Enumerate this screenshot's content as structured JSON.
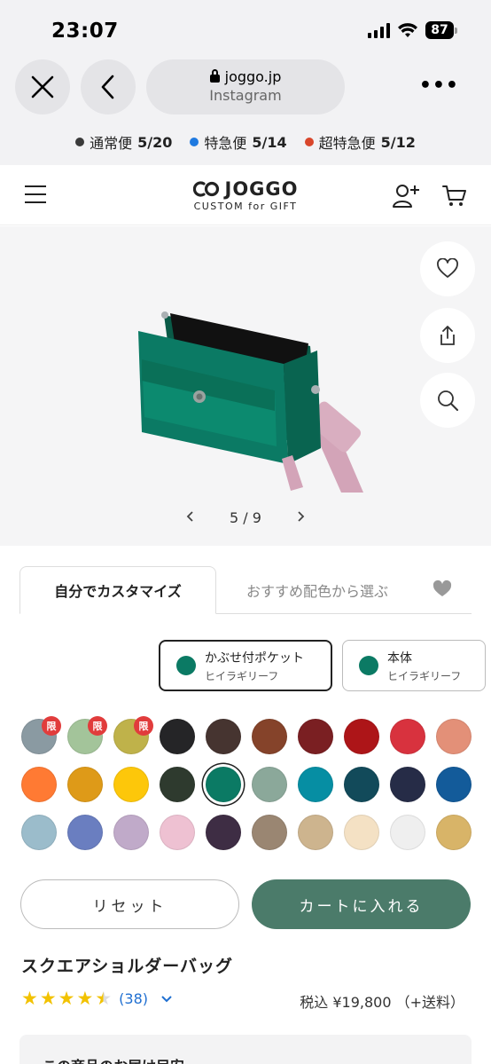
{
  "status": {
    "time": "23:07",
    "battery": "87"
  },
  "browser": {
    "domain": "joggo.jp",
    "source": "Instagram",
    "menu": "•••"
  },
  "delivery": [
    {
      "label": "通常便",
      "date": "5/20",
      "color": "#3a3a3a"
    },
    {
      "label": "特急便",
      "date": "5/14",
      "color": "#1f7ae0"
    },
    {
      "label": "超特急便",
      "date": "5/12",
      "color": "#d9462b"
    }
  ],
  "header": {
    "logo": "JOGGO",
    "tagline": "CUSTOM for GIFT"
  },
  "gallery": {
    "pager": "5 / 9"
  },
  "tabs": {
    "customize": "自分でカスタマイズ",
    "recommended": "おすすめ配色から選ぶ"
  },
  "parts": [
    {
      "name": "かぶせ付ポケット",
      "color": "ヒイラギリーフ"
    },
    {
      "name": "本体",
      "color": "ヒイラギリーフ"
    }
  ],
  "swatch_badge": "限",
  "swatches": [
    [
      "#8a9aa2",
      "#a3c49a",
      "#bfb24a",
      "#252527",
      "#463430",
      "#85432a",
      "#7a1f22",
      "#ad1518",
      "#d8323e",
      "#e39078"
    ],
    [
      "#ff7a33",
      "#de9a18",
      "#fdc70a",
      "#2e3a2e",
      "#0b7a64",
      "#8ba89a",
      "#068ea3",
      "#124a5a",
      "#262c47",
      "#135b9a"
    ],
    [
      "#9bbccb",
      "#6a7ec0",
      "#c0aac9",
      "#eec1d2",
      "#3e2d44",
      "#9a8672",
      "#cdb48e",
      "#f4e1c4",
      "#efefef",
      "#d8b468"
    ]
  ],
  "selected_swatch": "#0b7a64",
  "actions": {
    "reset": "リセット",
    "add_to_cart": "カートに入れる"
  },
  "product": {
    "title": "スクエアショルダーバッグ",
    "rating": 4.5,
    "review_count": "(38)",
    "price": "税込 ¥19,800 （+送料）"
  },
  "bottom": {
    "text": "この商品のお届け目安"
  }
}
